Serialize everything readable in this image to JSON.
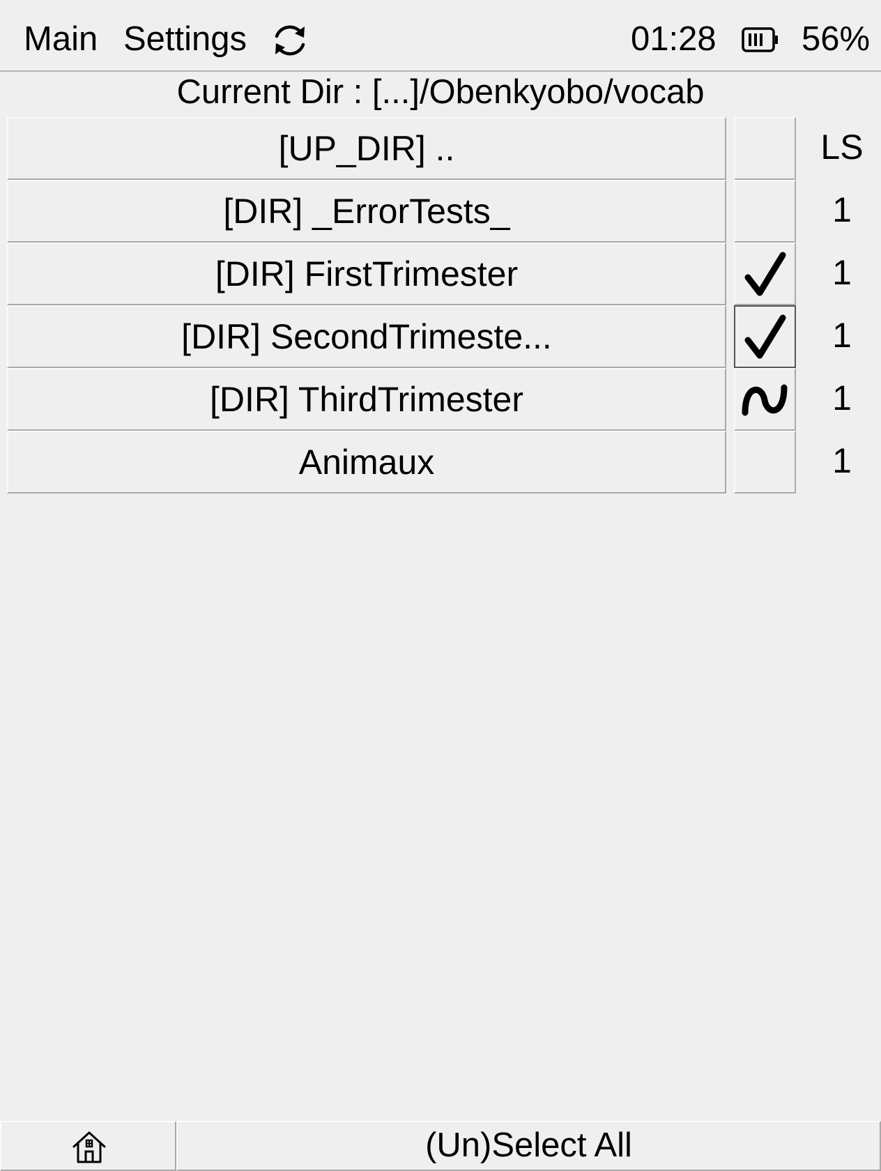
{
  "topbar": {
    "menu_main": "Main",
    "menu_settings": "Settings",
    "sync_icon": "sync-icon",
    "clock": "01:28",
    "battery_icon": "battery-icon",
    "battery_percent": "56%"
  },
  "current_dir": "Current Dir : [...]/Obenkyobo/vocab",
  "list": {
    "ls_header": "LS",
    "rows": [
      {
        "name": "[UP_DIR] ..",
        "state": "empty",
        "ls": ""
      },
      {
        "name": "[DIR] _ErrorTests_",
        "state": "empty",
        "ls": "1"
      },
      {
        "name": "[DIR] FirstTrimester",
        "state": "checked",
        "ls": "1"
      },
      {
        "name": "[DIR] SecondTrimeste...",
        "state": "checked",
        "ls": "1"
      },
      {
        "name": "[DIR] ThirdTrimester",
        "state": "partial",
        "ls": "1"
      },
      {
        "name": "Animaux",
        "state": "empty",
        "ls": "1"
      }
    ]
  },
  "bottombar": {
    "home_icon": "home-icon",
    "select_all_label": "(Un)Select All"
  }
}
